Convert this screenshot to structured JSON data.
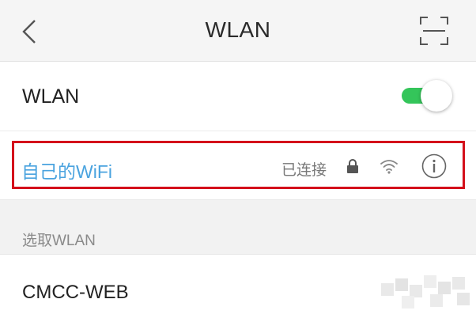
{
  "header": {
    "title": "WLAN",
    "back_icon": "chevron-left-icon",
    "scan_icon": "scan-frame-icon"
  },
  "wlan_toggle": {
    "label": "WLAN",
    "enabled": true,
    "accent_color": "#34c55a"
  },
  "connected_network": {
    "ssid": "自己的WiFi",
    "status": "已连接",
    "secured": true,
    "ssid_color": "#4aa3df",
    "highlight_color": "#d4101b"
  },
  "available_section": {
    "label": "选取WLAN",
    "networks": [
      {
        "ssid": "CMCC-WEB"
      }
    ]
  }
}
